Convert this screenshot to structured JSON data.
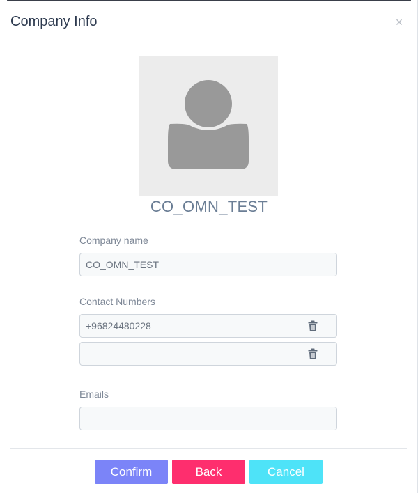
{
  "modal": {
    "title": "Company Info",
    "close_symbol": "×",
    "close_icon": "close-icon"
  },
  "profile": {
    "avatar_icon": "user-avatar-icon",
    "company_display_name": "CO_OMN_TEST"
  },
  "form": {
    "company_name": {
      "label": "Company name",
      "value": "CO_OMN_TEST"
    },
    "contact_numbers": {
      "label": "Contact Numbers",
      "entries": [
        "+96824480228",
        ""
      ],
      "delete_icon": "trash-icon"
    },
    "emails": {
      "label": "Emails",
      "value": ""
    }
  },
  "actions": {
    "confirm_label": "Confirm",
    "back_label": "Back",
    "cancel_label": "Cancel"
  },
  "colors": {
    "confirm": "#7b84f8",
    "back": "#fe2e6e",
    "cancel": "#4ee3f8",
    "avatar_bg": "#ececec",
    "avatar_fg": "#999999"
  }
}
